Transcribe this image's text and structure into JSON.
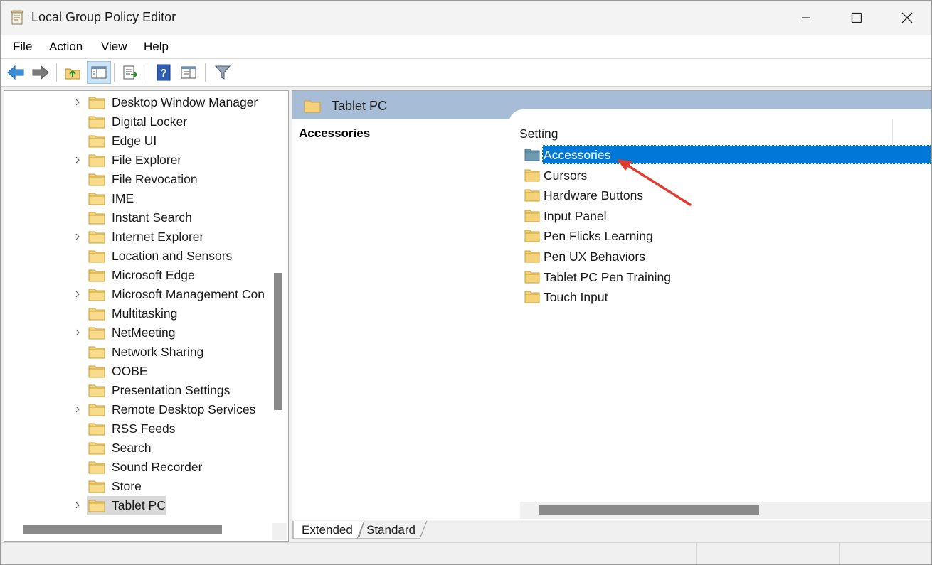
{
  "window": {
    "title": "Local Group Policy Editor"
  },
  "menu": [
    "File",
    "Action",
    "View",
    "Help"
  ],
  "toolbar": {
    "buttons": [
      "back-icon",
      "forward-icon",
      "up-folder-icon",
      "show-hide-tree-icon",
      "export-list-icon",
      "help-icon",
      "properties-icon",
      "filter-icon"
    ]
  },
  "tree": {
    "items": [
      {
        "label": "Desktop Window Manager",
        "expandable": true
      },
      {
        "label": "Digital Locker",
        "expandable": false
      },
      {
        "label": "Edge UI",
        "expandable": false
      },
      {
        "label": "File Explorer",
        "expandable": true
      },
      {
        "label": "File Revocation",
        "expandable": false
      },
      {
        "label": "IME",
        "expandable": false
      },
      {
        "label": "Instant Search",
        "expandable": false
      },
      {
        "label": "Internet Explorer",
        "expandable": true
      },
      {
        "label": "Location and Sensors",
        "expandable": false
      },
      {
        "label": "Microsoft Edge",
        "expandable": false
      },
      {
        "label": "Microsoft Management Con",
        "expandable": true
      },
      {
        "label": "Multitasking",
        "expandable": false
      },
      {
        "label": "NetMeeting",
        "expandable": true
      },
      {
        "label": "Network Sharing",
        "expandable": false
      },
      {
        "label": "OOBE",
        "expandable": false
      },
      {
        "label": "Presentation Settings",
        "expandable": false
      },
      {
        "label": "Remote Desktop Services",
        "expandable": true
      },
      {
        "label": "RSS Feeds",
        "expandable": false
      },
      {
        "label": "Search",
        "expandable": false
      },
      {
        "label": "Sound Recorder",
        "expandable": false
      },
      {
        "label": "Store",
        "expandable": false
      },
      {
        "label": "Tablet PC",
        "expandable": true,
        "selected": true
      }
    ]
  },
  "detail": {
    "header_title": "Tablet PC",
    "description_title": "Accessories",
    "column_header": "Setting",
    "items": [
      {
        "label": "Accessories",
        "selected": true
      },
      {
        "label": "Cursors"
      },
      {
        "label": "Hardware Buttons"
      },
      {
        "label": "Input Panel"
      },
      {
        "label": "Pen Flicks Learning"
      },
      {
        "label": "Pen UX Behaviors"
      },
      {
        "label": "Tablet PC Pen Training"
      },
      {
        "label": "Touch Input"
      }
    ]
  },
  "tabs": [
    "Extended",
    "Standard"
  ],
  "colors": {
    "selection": "#0078d7",
    "header": "#a6bcd7",
    "annotation_arrow": "#e03c31",
    "folder": "#f3d27a"
  }
}
